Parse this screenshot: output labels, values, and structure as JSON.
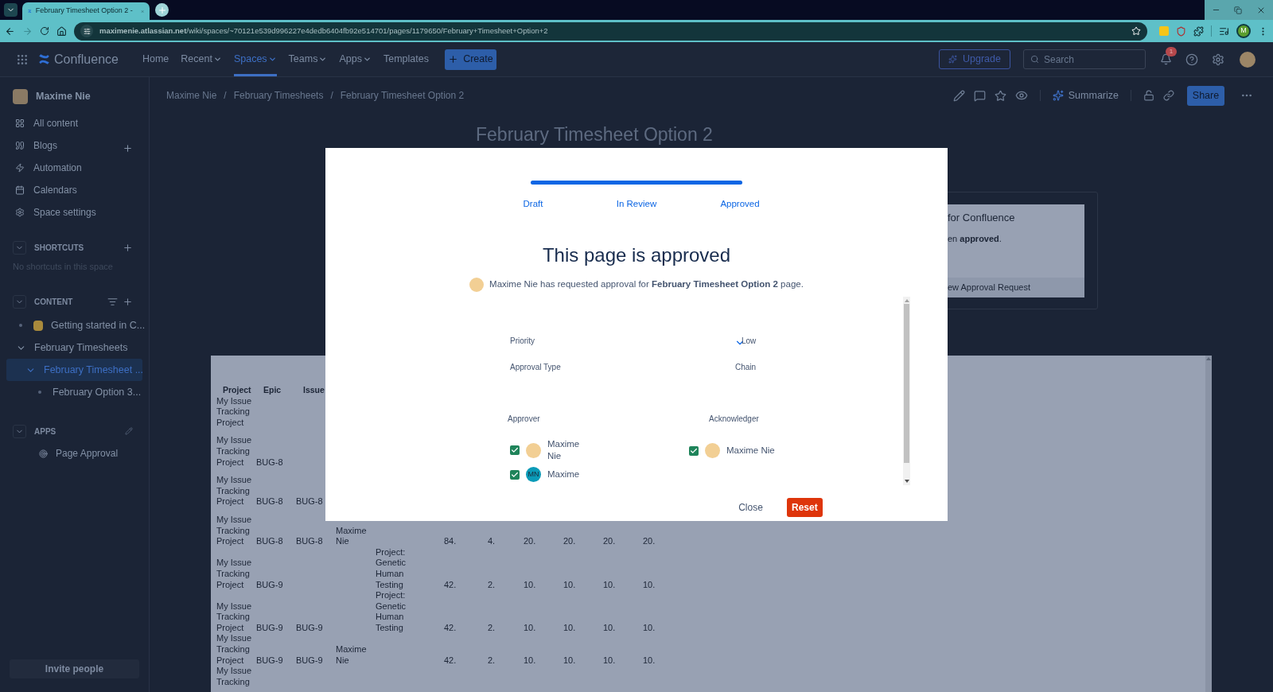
{
  "browser": {
    "tab_title": "February Timesheet Option 2 -",
    "url": "**maximenie.atlassian.net**/wiki/spaces/~70121e539d996227e4dedb6404fb92e514701/pages/1179650/February+Timesheet+Option+2",
    "profile_initial": "M"
  },
  "topnav": {
    "product": "Confluence",
    "items": [
      {
        "label": "Home",
        "dropdown": false,
        "selected": false
      },
      {
        "label": "Recent",
        "dropdown": true,
        "selected": false
      },
      {
        "label": "Spaces",
        "dropdown": true,
        "selected": true
      },
      {
        "label": "Teams",
        "dropdown": true,
        "selected": false
      },
      {
        "label": "Apps",
        "dropdown": true,
        "selected": false
      },
      {
        "label": "Templates",
        "dropdown": false,
        "selected": false
      }
    ],
    "create": "Create",
    "upgrade": "Upgrade",
    "search_placeholder": "Search",
    "notification_count": "1"
  },
  "sidebar": {
    "space": "Maxime Nie",
    "nav": [
      {
        "label": "All content",
        "add": false
      },
      {
        "label": "Blogs",
        "add": true
      },
      {
        "label": "Automation",
        "add": false
      },
      {
        "label": "Calendars",
        "add": false
      },
      {
        "label": "Space settings",
        "add": false
      }
    ],
    "shortcuts": {
      "title": "SHORTCUTS",
      "empty": "No shortcuts in this space"
    },
    "content": {
      "title": "CONTENT",
      "tree": [
        {
          "label": "Getting started in C...",
          "selected": false
        },
        {
          "label": "February Timesheets",
          "selected": false,
          "expanded": true,
          "children": [
            {
              "label": "February Timesheet ...",
              "selected": true,
              "expanded": true,
              "children": [
                {
                  "label": "February Option 3...",
                  "selected": false
                }
              ]
            }
          ]
        }
      ]
    },
    "apps": {
      "title": "APPS",
      "items": [
        "Page Approval"
      ]
    },
    "invite": "Invite people"
  },
  "breadcrumbs": {
    "items": [
      "Maxime Nie",
      "February Timesheets",
      "February Timesheet Option 2"
    ],
    "separator": "/"
  },
  "page_actions": {
    "summarize": "Summarize",
    "share": "Share"
  },
  "page": {
    "title": "February Timesheet Option 2",
    "approval_card": {
      "title": "for Confluence",
      "message": "en **approved**.",
      "link": "ew Approval Request"
    },
    "table": {
      "columns": [
        "Project",
        "Epic",
        "Issue"
      ],
      "rows": [
        {
          "project": "My Issue Tracking Project"
        },
        {
          "project": "My Issue Tracking Project",
          "epic": "BUG-8"
        },
        {
          "project": "My Issue Tracking Project",
          "epic": "BUG-8",
          "issue": "BUG-8"
        },
        {
          "project": "My Issue Tracking Project",
          "epic": "BUG-8",
          "issue": "BUG-8",
          "column_4": "Maxime Nie",
          "column_6": "84.",
          "column_7": "4.",
          "column_8": "20.",
          "column_9": "20.",
          "column_10": "20.",
          "column_11": "20."
        },
        {
          "project": "My Issue Tracking Project",
          "epic": "BUG-9",
          "column_5": "Project: Genetic Human Testing",
          "column_6": "42.",
          "column_7": "2.",
          "column_8": "10.",
          "column_9": "10.",
          "column_10": "10.",
          "column_11": "10."
        },
        {
          "project": "My Issue Tracking Project",
          "epic": "BUG-9",
          "issue": "BUG-9",
          "column_5": "Project: Genetic Human Testing",
          "column_6": "42.",
          "column_7": "2.",
          "column_8": "10.",
          "column_9": "10.",
          "column_10": "10.",
          "column_11": "10."
        },
        {
          "project": "My Issue Tracking Project",
          "epic": "BUG-9",
          "issue": "BUG-9",
          "column_4": "Maxime Nie",
          "column_6": "42.",
          "column_7": "2.",
          "column_8": "10.",
          "column_9": "10.",
          "column_10": "10.",
          "column_11": "10."
        },
        {
          "project": "My Issue Tracking"
        }
      ]
    }
  },
  "modal": {
    "progress": {
      "level": 1
    },
    "steps": [
      {
        "label": "Draft"
      },
      {
        "label": "In Review"
      },
      {
        "label": "Approved"
      }
    ],
    "title": "This page is approved",
    "request": "Maxime Nie has requested approval for **February Timesheet Option 2** page.",
    "fields": [
      {
        "label": "Priority",
        "value": "Low",
        "dropdown": true
      },
      {
        "label": "Approval Type",
        "value": "Chain",
        "dropdown": false
      }
    ],
    "approver_label": "Approver",
    "acknowledger_label": "Acknowledger",
    "approvers": [
      {
        "name": "Maxime Nie",
        "checked": true
      },
      {
        "name": "Maxime",
        "checked": true,
        "initials": "MN"
      }
    ],
    "acknowledgers": [
      {
        "name": "Maxime Nie",
        "checked": true
      }
    ],
    "close": "Close",
    "reset": "Reset"
  }
}
